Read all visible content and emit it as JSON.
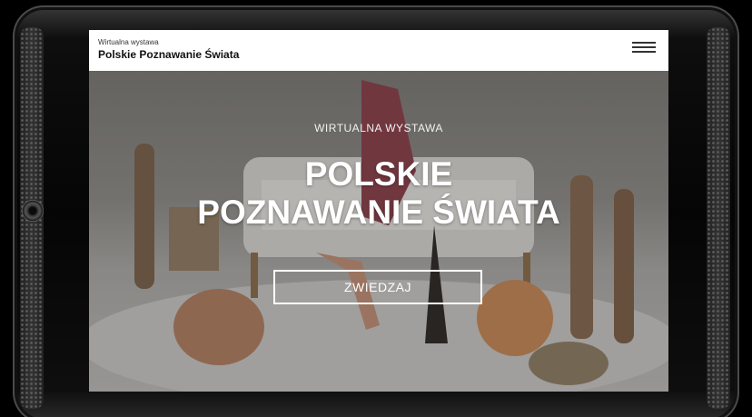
{
  "header": {
    "subtitle": "Wirtualna wystawa",
    "title": "Polskie Poznawanie Świata",
    "menu_icon": "hamburger-icon"
  },
  "hero": {
    "kicker": "WIRTUALNA WYSTAWA",
    "title_line1": "POLSKIE",
    "title_line2": "POZNAWANIE ŚWIATA",
    "button_label": "ZWIEDZAJ"
  }
}
